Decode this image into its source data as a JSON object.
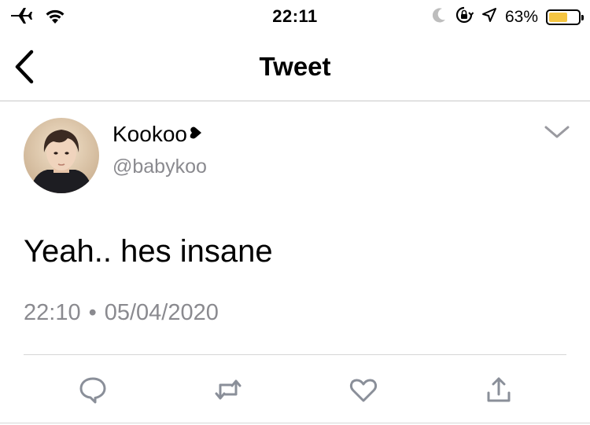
{
  "status_bar": {
    "time": "22:11",
    "battery_percent_label": "63%",
    "battery_level": 0.63,
    "battery_color": "#f5c542",
    "left_icons": [
      "airplane-icon",
      "wifi-icon"
    ],
    "right_icons": [
      "moon-icon",
      "rotation-lock-icon",
      "location-arrow-icon",
      "battery-icon"
    ]
  },
  "nav": {
    "title": "Tweet",
    "back_icon": "chevron-left-icon"
  },
  "tweet": {
    "display_name": "Kookoo",
    "name_emoji": "heart-icon",
    "handle": "@babykoo",
    "text": "Yeah.. hes insane",
    "time": "22:10",
    "separator": "•",
    "date": "05/04/2020",
    "menu_icon": "chevron-down-icon"
  },
  "actions": [
    "reply-icon",
    "retweet-icon",
    "like-icon",
    "share-icon"
  ],
  "colors": {
    "secondary_text": "#8a8a8f",
    "icon_gray": "#8a8f99",
    "divider": "#d6d6d6"
  }
}
